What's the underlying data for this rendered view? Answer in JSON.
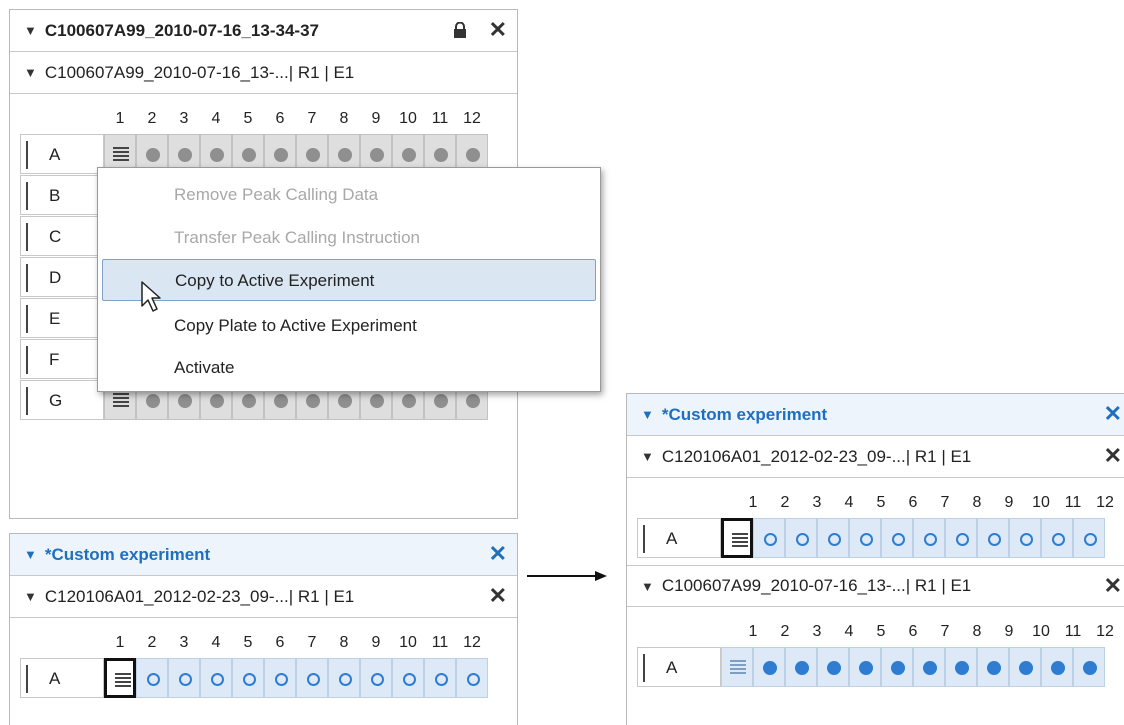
{
  "left_panel": {
    "title": "C100607A99_2010-07-16_13-34-37",
    "plate_title": "C100607A99_2010-07-16_13-...| R1 | E1",
    "columns": [
      "1",
      "2",
      "3",
      "4",
      "5",
      "6",
      "7",
      "8",
      "9",
      "10",
      "11",
      "12"
    ],
    "rows": [
      "A",
      "B",
      "C",
      "D",
      "E",
      "F",
      "G"
    ]
  },
  "context_menu": {
    "items": [
      {
        "label": "Remove Peak Calling Data",
        "enabled": false
      },
      {
        "label": "Transfer Peak Calling Instruction",
        "enabled": false
      },
      {
        "label": "Copy to Active Experiment",
        "enabled": true,
        "highlighted": true
      },
      {
        "label": "Copy Plate to Active Experiment",
        "enabled": true
      },
      {
        "label": "Activate",
        "enabled": true
      }
    ]
  },
  "bottom_panel": {
    "title": "*Custom experiment",
    "plate_title": "C120106A01_2012-02-23_09-...| R1 | E1",
    "columns": [
      "1",
      "2",
      "3",
      "4",
      "5",
      "6",
      "7",
      "8",
      "9",
      "10",
      "11",
      "12"
    ],
    "row": "A"
  },
  "right_panel": {
    "title": "*Custom experiment",
    "plate1_title": "C120106A01_2012-02-23_09-...| R1 | E1",
    "plate2_title": "C100607A99_2010-07-16_13-...| R1 | E1",
    "columns": [
      "1",
      "2",
      "3",
      "4",
      "5",
      "6",
      "7",
      "8",
      "9",
      "10",
      "11",
      "12"
    ],
    "row": "A"
  },
  "colors": {
    "accent": "#1f6fbf",
    "well_blue": "#dde9f6",
    "well_gray": "#dedede",
    "highlight": "#dbe6f3"
  },
  "icons": {
    "lock": "lock-icon",
    "close": "close-icon",
    "collapse": "collapse-triangle-icon",
    "cursor": "mouse-cursor-icon",
    "arrow": "right-arrow-icon"
  }
}
